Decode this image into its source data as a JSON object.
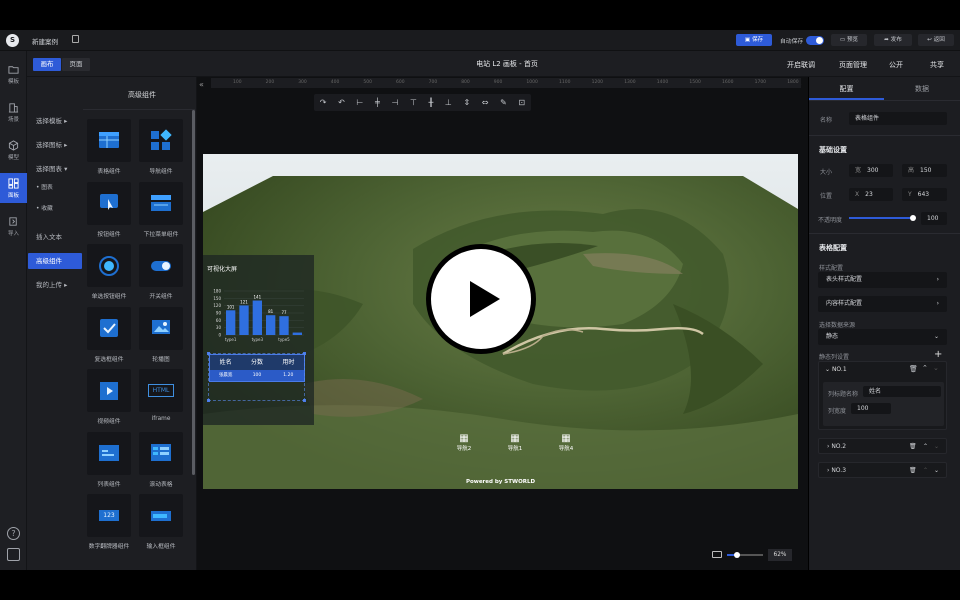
{
  "topbar": {
    "project_name": "新建案例",
    "save_label": "保存",
    "autosave_label": "自动保存",
    "preview_label": "预览",
    "publish_label": "发布",
    "back_label": "返回"
  },
  "subbar": {
    "tabs": [
      {
        "label": "画布"
      },
      {
        "label": "页面"
      }
    ],
    "title": "电站 L2 画板 - 首页",
    "actions": [
      {
        "label": "开启联调"
      },
      {
        "label": "页面管理"
      },
      {
        "label": "公开"
      },
      {
        "label": "共享"
      }
    ]
  },
  "rail": {
    "items": [
      {
        "label": "模板"
      },
      {
        "label": "场景"
      },
      {
        "label": "模型"
      },
      {
        "label": "面板"
      },
      {
        "label": "导入"
      }
    ]
  },
  "left_panel": {
    "title": "高级组件",
    "categories": [
      {
        "label": "选择模板",
        "arrow": "▸"
      },
      {
        "label": "选择图标",
        "arrow": "▸"
      },
      {
        "label": "选择图表",
        "arrow": "▾"
      },
      {
        "label": "• 图表"
      },
      {
        "label": "• 收藏"
      },
      {
        "label": "插入文本"
      },
      {
        "label": "高级组件"
      },
      {
        "label": "我的上传",
        "arrow": "▸"
      }
    ],
    "components": [
      {
        "label": "表格组件",
        "icon": "table-icon"
      },
      {
        "label": "导航组件",
        "icon": "navigation-icon"
      },
      {
        "label": "按钮组件",
        "icon": "button-icon"
      },
      {
        "label": "下拉菜单组件",
        "icon": "dropdown-icon"
      },
      {
        "label": "单选按钮组件",
        "icon": "radio-icon"
      },
      {
        "label": "开关组件",
        "icon": "switch-icon"
      },
      {
        "label": "复选框组件",
        "icon": "checkbox-icon"
      },
      {
        "label": "轮播图",
        "icon": "carousel-icon"
      },
      {
        "label": "视频组件",
        "icon": "video-icon"
      },
      {
        "label": "iframe",
        "icon": "iframe-icon"
      },
      {
        "label": "列表组件",
        "icon": "list-icon"
      },
      {
        "label": "滚动表格",
        "icon": "scroll-table-icon"
      },
      {
        "label": "数字翻牌器组件",
        "icon": "number-flip-icon"
      },
      {
        "label": "输入框组件",
        "icon": "input-icon"
      }
    ],
    "iframe_text": "HTML",
    "number_text": "123"
  },
  "ruler": {
    "ticks": [
      "100",
      "200",
      "300",
      "400",
      "500",
      "600",
      "700",
      "800",
      "900",
      "1000",
      "1100",
      "1200",
      "1300",
      "1400",
      "1500",
      "1600",
      "1700",
      "1800"
    ]
  },
  "canvas": {
    "widget_title": "可视化大屏",
    "chart_data": {
      "type": "bar",
      "categories": [
        "type1",
        "",
        "type3",
        "",
        "type5",
        ""
      ],
      "values": [
        101,
        121,
        141,
        81,
        77,
        10
      ],
      "ylim": [
        0,
        180
      ],
      "yticks": [
        "180",
        "150",
        "120",
        "90",
        "60",
        "30",
        "0"
      ],
      "bar_color": "#2f6fe0"
    },
    "table": {
      "headers": [
        "姓名",
        "分数",
        "用时"
      ],
      "rows": [
        [
          "张晨宽",
          "100",
          "1.20"
        ]
      ]
    },
    "nav_items": [
      {
        "label": "导航2"
      },
      {
        "label": "导航1"
      },
      {
        "label": "导航4"
      }
    ],
    "powered_by": "Powered by STWORLD",
    "zoom": "62%"
  },
  "right_panel": {
    "tabs": [
      {
        "label": "配置"
      },
      {
        "label": "数据"
      }
    ],
    "name_label": "名称",
    "name_value": "表格组件",
    "basic_title": "基础设置",
    "size_label": "大小",
    "width_prefix": "宽",
    "width_value": "300",
    "height_prefix": "高",
    "height_value": "150",
    "pos_label": "位置",
    "x_prefix": "X",
    "x_value": "23",
    "y_prefix": "Y",
    "y_value": "643",
    "opacity_label": "不透明度",
    "opacity_value": "100",
    "opacity_level": 1.0,
    "table_title": "表格配置",
    "style_label": "样式配置",
    "header_style": "表头样式配置",
    "content_style": "内容样式配置",
    "source_label": "选择数据来源",
    "source_value": "静态",
    "static_cols_label": "静态列设置",
    "columns": [
      {
        "label": "NO.1"
      },
      {
        "label": "NO.2"
      },
      {
        "label": "NO.3"
      }
    ],
    "col_name_label": "列标题名称",
    "col_name_value": "姓名",
    "col_width_label": "列宽度",
    "col_width_value": "100"
  },
  "colors": {
    "accent": "#2e5bd8",
    "panel": "#1d1e22"
  }
}
